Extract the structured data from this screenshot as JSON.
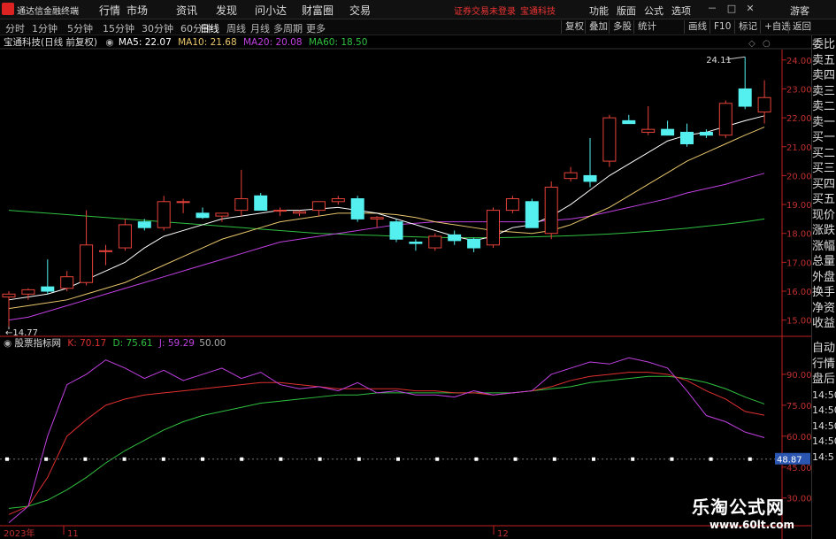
{
  "app": {
    "title": "通达信金融终端"
  },
  "menu": [
    "行情",
    "市场",
    "资讯",
    "发现",
    "问小达",
    "财富圈",
    "交易"
  ],
  "alerts": {
    "login": "证券交易未登录",
    "stock": "宝通科技"
  },
  "right_menu": [
    "功能",
    "版面",
    "公式",
    "选项"
  ],
  "window_buttons": [
    "－",
    "□",
    "✕"
  ],
  "guest": "游客",
  "periods": [
    "分时",
    "1分钟",
    "5分钟",
    "15分钟",
    "30分钟",
    "60分钟",
    "日线",
    "周线",
    "月线",
    "多周期",
    "更多"
  ],
  "active_period": "日线",
  "toolbar": [
    "复权",
    "叠加",
    "多股",
    "统计",
    "画线",
    "F10",
    "标记",
    "+自选",
    "返回"
  ],
  "info": {
    "stock": "宝通科技(日线 前复权)",
    "ma5": "MA5: 22.07",
    "ma10": "MA10: 21.68",
    "ma20": "MA20: 20.08",
    "ma60": "MA60: 18.50"
  },
  "indicator": {
    "name": "股票指标网",
    "k": "K: 70.17",
    "d": "D: 75.61",
    "j": "J: 59.29",
    "level": "50.00",
    "last_label": "48.87"
  },
  "sidebar": [
    "委比",
    "卖五",
    "卖四",
    "卖三",
    "卖二",
    "卖一",
    "买一",
    "买二",
    "买三",
    "买四",
    "买五",
    "现价",
    "涨跌",
    "涨幅",
    "总量",
    "外盘",
    "换手",
    "净资",
    "收益",
    "自动",
    "行情",
    "盘后",
    "14:50",
    "14:50",
    "14:50",
    "14:50",
    "14:5"
  ],
  "watermark": {
    "line1": "乐淘公式网",
    "line2": "www.60lt.com"
  },
  "colors": {
    "up": "#e8433a",
    "down": "#54f0f0",
    "ma5": "#ffffff",
    "ma10": "#e8c66b",
    "ma20": "#c040e0",
    "ma60": "#30c040",
    "k": "#e03030",
    "d": "#30c040",
    "j": "#c040e0"
  },
  "chart_data": {
    "type": "candlestick",
    "price_axis": {
      "ticks": [
        15.0,
        16.0,
        17.0,
        18.0,
        19.0,
        20.0,
        21.0,
        22.0,
        23.0,
        24.0
      ],
      "ylim": [
        14.5,
        24.3
      ]
    },
    "annotations": {
      "high": "24.11",
      "low": "14.77"
    },
    "candles": [
      {
        "o": 15.8,
        "h": 16.0,
        "l": 14.77,
        "c": 15.9
      },
      {
        "o": 15.9,
        "h": 16.1,
        "l": 15.7,
        "c": 16.05
      },
      {
        "o": 16.15,
        "h": 17.1,
        "l": 15.9,
        "c": 16.0
      },
      {
        "o": 16.1,
        "h": 16.7,
        "l": 16.0,
        "c": 16.5
      },
      {
        "o": 16.3,
        "h": 18.8,
        "l": 16.2,
        "c": 17.6
      },
      {
        "o": 17.4,
        "h": 17.6,
        "l": 16.9,
        "c": 17.4
      },
      {
        "o": 17.5,
        "h": 18.5,
        "l": 17.4,
        "c": 18.3
      },
      {
        "o": 18.4,
        "h": 18.5,
        "l": 18.1,
        "c": 18.2
      },
      {
        "o": 18.2,
        "h": 19.3,
        "l": 18.1,
        "c": 19.1
      },
      {
        "o": 19.1,
        "h": 19.2,
        "l": 18.7,
        "c": 19.1
      },
      {
        "o": 18.7,
        "h": 18.9,
        "l": 18.5,
        "c": 18.55
      },
      {
        "o": 18.6,
        "h": 18.7,
        "l": 18.4,
        "c": 18.7
      },
      {
        "o": 18.8,
        "h": 20.2,
        "l": 18.6,
        "c": 19.2
      },
      {
        "o": 19.3,
        "h": 19.4,
        "l": 18.8,
        "c": 18.8
      },
      {
        "o": 18.8,
        "h": 18.9,
        "l": 18.6,
        "c": 18.8
      },
      {
        "o": 18.7,
        "h": 18.8,
        "l": 18.6,
        "c": 18.75
      },
      {
        "o": 18.8,
        "h": 19.1,
        "l": 18.6,
        "c": 19.1
      },
      {
        "o": 19.1,
        "h": 19.3,
        "l": 19.0,
        "c": 19.2
      },
      {
        "o": 19.2,
        "h": 19.3,
        "l": 18.4,
        "c": 18.5
      },
      {
        "o": 18.5,
        "h": 18.6,
        "l": 18.2,
        "c": 18.55
      },
      {
        "o": 18.4,
        "h": 18.5,
        "l": 17.7,
        "c": 17.8
      },
      {
        "o": 17.7,
        "h": 17.8,
        "l": 17.4,
        "c": 17.65
      },
      {
        "o": 17.5,
        "h": 18.0,
        "l": 17.4,
        "c": 17.9
      },
      {
        "o": 17.95,
        "h": 18.1,
        "l": 17.6,
        "c": 17.75
      },
      {
        "o": 17.8,
        "h": 17.85,
        "l": 17.35,
        "c": 17.5
      },
      {
        "o": 17.6,
        "h": 18.9,
        "l": 17.5,
        "c": 18.8
      },
      {
        "o": 18.8,
        "h": 19.3,
        "l": 18.7,
        "c": 19.2
      },
      {
        "o": 19.1,
        "h": 19.2,
        "l": 18.2,
        "c": 18.2
      },
      {
        "o": 18.0,
        "h": 19.8,
        "l": 17.8,
        "c": 19.6
      },
      {
        "o": 19.9,
        "h": 20.3,
        "l": 19.8,
        "c": 20.1
      },
      {
        "o": 20.0,
        "h": 21.3,
        "l": 19.6,
        "c": 19.8
      },
      {
        "o": 20.5,
        "h": 22.1,
        "l": 20.3,
        "c": 22.0
      },
      {
        "o": 21.9,
        "h": 22.1,
        "l": 21.8,
        "c": 21.8
      },
      {
        "o": 21.5,
        "h": 22.4,
        "l": 21.4,
        "c": 21.6
      },
      {
        "o": 21.6,
        "h": 21.9,
        "l": 21.4,
        "c": 21.4
      },
      {
        "o": 21.5,
        "h": 21.8,
        "l": 21.0,
        "c": 21.1
      },
      {
        "o": 21.5,
        "h": 21.6,
        "l": 21.3,
        "c": 21.4
      },
      {
        "o": 21.4,
        "h": 22.6,
        "l": 21.3,
        "c": 22.5
      },
      {
        "o": 23.0,
        "h": 24.11,
        "l": 22.3,
        "c": 22.4
      },
      {
        "o": 22.2,
        "h": 23.3,
        "l": 21.8,
        "c": 22.7
      }
    ],
    "ma5": [
      15.7,
      15.8,
      15.9,
      16.1,
      16.4,
      16.7,
      17.0,
      17.5,
      17.9,
      18.1,
      18.3,
      18.5,
      18.6,
      18.7,
      18.8,
      18.8,
      18.85,
      18.9,
      18.8,
      18.7,
      18.5,
      18.3,
      18.1,
      17.9,
      17.75,
      17.9,
      18.2,
      18.3,
      18.6,
      19.0,
      19.5,
      20.0,
      20.4,
      20.8,
      21.2,
      21.4,
      21.5,
      21.7,
      21.9,
      22.07
    ],
    "ma10": [
      15.4,
      15.5,
      15.6,
      15.7,
      15.9,
      16.1,
      16.3,
      16.6,
      16.9,
      17.2,
      17.5,
      17.8,
      18.0,
      18.2,
      18.4,
      18.5,
      18.6,
      18.7,
      18.7,
      18.7,
      18.65,
      18.55,
      18.4,
      18.3,
      18.2,
      18.1,
      18.05,
      18.0,
      18.1,
      18.3,
      18.6,
      18.9,
      19.3,
      19.7,
      20.1,
      20.5,
      20.8,
      21.1,
      21.4,
      21.68
    ],
    "ma20": [
      15.0,
      15.1,
      15.3,
      15.5,
      15.7,
      15.9,
      16.1,
      16.3,
      16.5,
      16.7,
      16.9,
      17.1,
      17.3,
      17.5,
      17.7,
      17.8,
      17.9,
      18.0,
      18.1,
      18.2,
      18.3,
      18.35,
      18.4,
      18.4,
      18.4,
      18.4,
      18.4,
      18.4,
      18.45,
      18.5,
      18.6,
      18.75,
      18.9,
      19.05,
      19.2,
      19.4,
      19.55,
      19.7,
      19.9,
      20.08
    ],
    "ma60": [
      18.8,
      18.75,
      18.7,
      18.65,
      18.6,
      18.55,
      18.5,
      18.45,
      18.4,
      18.35,
      18.3,
      18.25,
      18.2,
      18.15,
      18.1,
      18.05,
      18.0,
      17.98,
      17.95,
      17.93,
      17.9,
      17.88,
      17.86,
      17.85,
      17.85,
      17.85,
      17.86,
      17.88,
      17.9,
      17.92,
      17.95,
      17.98,
      18.02,
      18.07,
      18.12,
      18.18,
      18.25,
      18.32,
      18.4,
      18.5
    ],
    "kdj_axis": {
      "ticks": [
        30.0,
        45.0,
        60.0,
        75.0,
        90.0
      ],
      "ylim": [
        20,
        105
      ]
    },
    "k": [
      22,
      26,
      40,
      60,
      68,
      75,
      78,
      80,
      81,
      82,
      83,
      84,
      85,
      86,
      86,
      85,
      84,
      83,
      83,
      83,
      83,
      82,
      82,
      81,
      81,
      80,
      81,
      82,
      84,
      87,
      89,
      90,
      91,
      91,
      90,
      87,
      82,
      78,
      72,
      70.17
    ],
    "d": [
      25,
      26,
      29,
      34,
      40,
      47,
      53,
      58,
      63,
      67,
      70,
      72,
      74,
      76,
      77,
      78,
      79,
      80,
      80,
      81,
      81,
      81,
      81,
      81,
      81,
      81,
      81,
      82,
      83,
      84,
      86,
      87,
      88,
      89,
      89,
      88,
      86,
      83,
      79,
      75.61
    ],
    "j": [
      18,
      26,
      60,
      85,
      90,
      97,
      93,
      88,
      92,
      87,
      90,
      93,
      88,
      91,
      85,
      83,
      84,
      82,
      86,
      81,
      82,
      80,
      80,
      79,
      82,
      80,
      81,
      82,
      90,
      93,
      96,
      95,
      98,
      96,
      93,
      82,
      70,
      67,
      62,
      59.29
    ],
    "x_labels": [
      "2023年",
      "11",
      "12"
    ]
  }
}
